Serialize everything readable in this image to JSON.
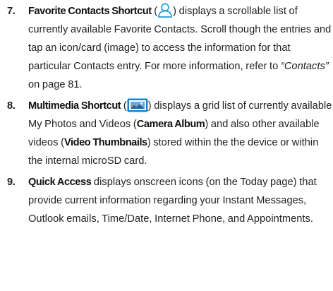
{
  "items": [
    {
      "number": "7.",
      "term": "Favorite Contacts Shortcut",
      "open_paren": " (",
      "icon": "person-icon",
      "text_a": ") displays a scrollable list of currently available Favorite Contacts. Scroll though the entries and tap an icon/card (image) to access the information for that particular Contacts entry. For more information, refer to ",
      "ref": "“Contacts”",
      "text_b": "  on page 81."
    },
    {
      "number": "8.",
      "term": "Multimedia Shortcut",
      "open_paren": " (",
      "icon": "photo-gallery-icon",
      "text_a": ") displays a grid list of currently available My Photos and Videos (",
      "bold_a": "Camera Album",
      "text_b": ") and also other available videos (",
      "bold_b": "Video Thumbnails",
      "text_c": ") stored within the the device or within the internal microSD card."
    },
    {
      "number": "9.",
      "term": "Quick Access",
      "text_a": " displays onscreen icons (on the Today page) that provide current information regarding your Instant Messages, Outlook emails, Time/Date, Internet Phone, and Appointments."
    }
  ],
  "colors": {
    "text": "#222222",
    "person_icon_stroke": "#1f9fd9",
    "media_icon_frame": "#1585c9"
  }
}
